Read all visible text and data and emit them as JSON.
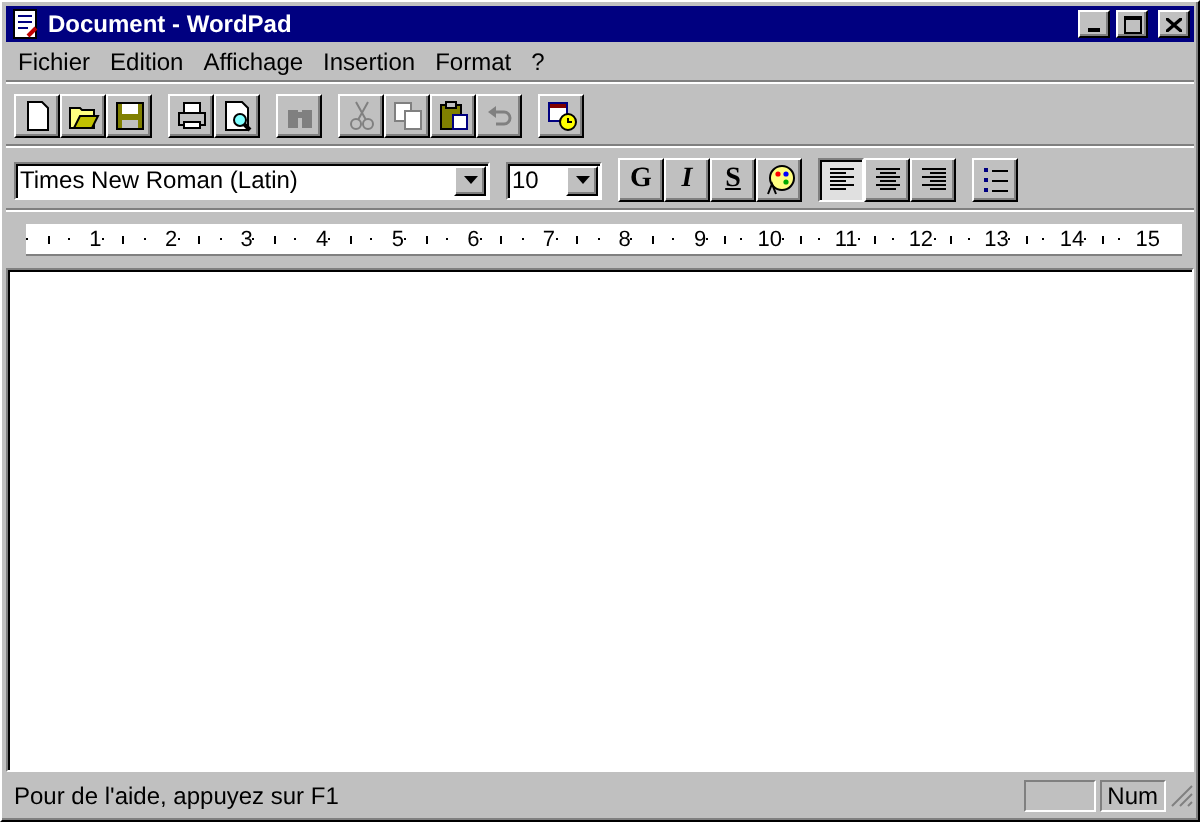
{
  "window": {
    "title": "Document - WordPad"
  },
  "menu": [
    "Fichier",
    "Edition",
    "Affichage",
    "Insertion",
    "Format",
    "?"
  ],
  "toolbar": [
    [
      {
        "kind": "new",
        "disabled": false
      },
      {
        "kind": "open",
        "disabled": false
      },
      {
        "kind": "save",
        "disabled": false
      }
    ],
    [
      {
        "kind": "print",
        "disabled": false
      },
      {
        "kind": "preview",
        "disabled": false
      }
    ],
    [
      {
        "kind": "find",
        "disabled": true
      }
    ],
    [
      {
        "kind": "cut",
        "disabled": true
      },
      {
        "kind": "copy",
        "disabled": true
      },
      {
        "kind": "paste",
        "disabled": false
      },
      {
        "kind": "undo",
        "disabled": true
      }
    ],
    [
      {
        "kind": "datetime",
        "disabled": false
      }
    ]
  ],
  "format_bar": {
    "font": "Times New Roman (Latin)",
    "size": "10",
    "styles": [
      {
        "kind": "bold",
        "label": "G"
      },
      {
        "kind": "italic",
        "label": "I"
      },
      {
        "kind": "underline",
        "label": "S"
      },
      {
        "kind": "color"
      }
    ],
    "align": [
      {
        "kind": "left",
        "selected": true
      },
      {
        "kind": "center",
        "selected": false
      },
      {
        "kind": "right",
        "selected": false
      }
    ],
    "bullets": {
      "selected": false
    }
  },
  "ruler": [
    "1",
    "2",
    "3",
    "4",
    "5",
    "6",
    "7",
    "8",
    "9",
    "10",
    "11",
    "12",
    "13",
    "14",
    "15"
  ],
  "status_bar": {
    "text": "Pour de l'aide, appuyez sur F1",
    "num_panel": "Num"
  }
}
